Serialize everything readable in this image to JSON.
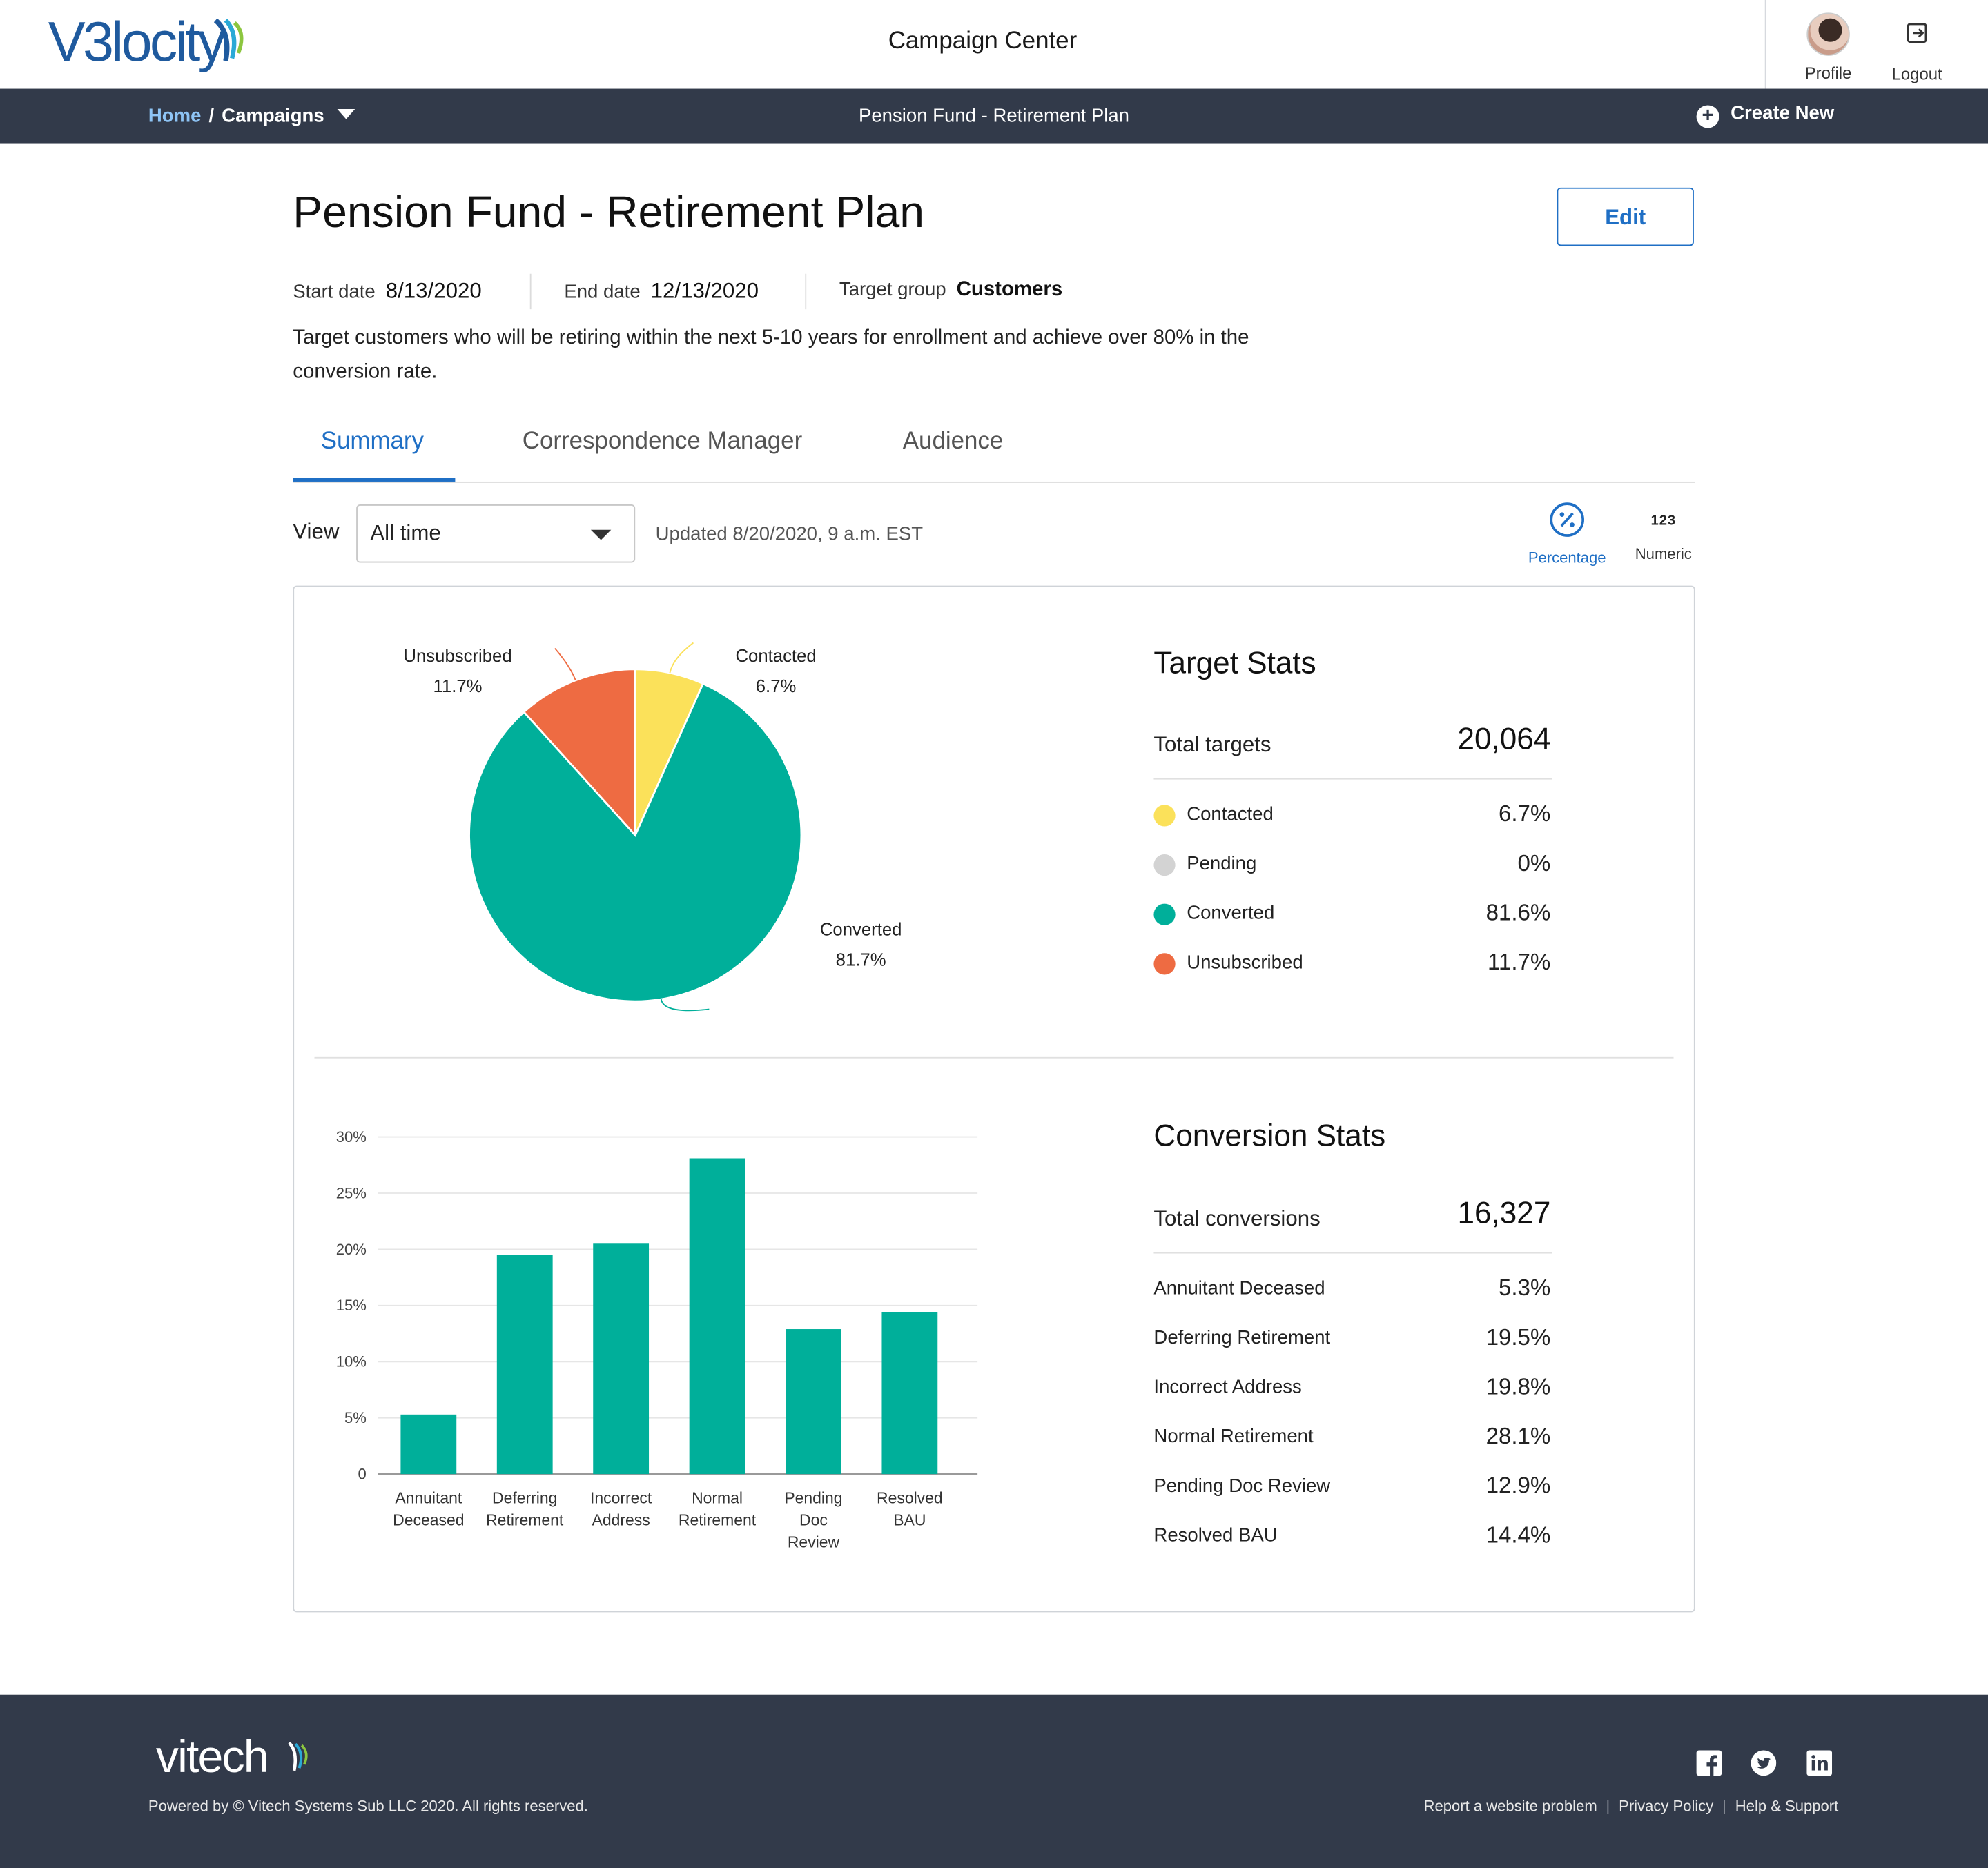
{
  "brand": {
    "logo_text": "V3locity"
  },
  "header": {
    "app_title": "Campaign Center",
    "profile_label": "Profile",
    "logout_label": "Logout"
  },
  "nav": {
    "home_label": "Home",
    "separator": "/",
    "campaigns_label": "Campaigns",
    "current_page": "Pension Fund - Retirement Plan",
    "create_new_label": "Create New"
  },
  "campaign": {
    "title": "Pension Fund - Retirement Plan",
    "edit_label": "Edit",
    "start_date_label": "Start date",
    "start_date": "8/13/2020",
    "end_date_label": "End date",
    "end_date": "12/13/2020",
    "target_group_label": "Target group",
    "target_group": "Customers",
    "description": "Target customers who will be retiring within the next 5-10 years for enrollment and achieve over 80% in the conversion rate."
  },
  "tabs": [
    {
      "label": "Summary",
      "active": true
    },
    {
      "label": "Correspondence Manager",
      "active": false
    },
    {
      "label": "Audience",
      "active": false
    }
  ],
  "controls": {
    "view_label": "View",
    "view_value": "All time",
    "updated_text": "Updated 8/20/2020, 9 a.m. EST",
    "percentage_label": "Percentage",
    "numeric_label": "Numeric",
    "numeric_glyph": "123"
  },
  "target_stats": {
    "title": "Target Stats",
    "total_label": "Total targets",
    "total_value": "20,064",
    "rows": [
      {
        "label": "Contacted",
        "value": "6.7%",
        "color": "#fbe15a"
      },
      {
        "label": "Pending",
        "value": "0%",
        "color": "#d3d3d3"
      },
      {
        "label": "Converted",
        "value": "81.6%",
        "color": "#00af9a"
      },
      {
        "label": "Unsubscribed",
        "value": "11.7%",
        "color": "#ee6b42"
      }
    ]
  },
  "conversion_stats": {
    "title": "Conversion Stats",
    "total_label": "Total conversions",
    "total_value": "16,327",
    "rows": [
      {
        "label": "Annuitant Deceased",
        "value": "5.3%"
      },
      {
        "label": "Deferring Retirement",
        "value": "19.5%"
      },
      {
        "label": "Incorrect Address",
        "value": "19.8%"
      },
      {
        "label": "Normal Retirement",
        "value": "28.1%"
      },
      {
        "label": "Pending Doc Review",
        "value": "12.9%"
      },
      {
        "label": "Resolved BAU",
        "value": "14.4%"
      }
    ]
  },
  "chart_data": [
    {
      "type": "pie",
      "slices": [
        {
          "label": "Unsubscribed",
          "value": 11.7,
          "display": "11.7%",
          "color": "#ee6b42"
        },
        {
          "label": "Contacted",
          "value": 6.7,
          "display": "6.7%",
          "color": "#fbe15a"
        },
        {
          "label": "Converted",
          "value": 81.7,
          "display": "81.7%",
          "color": "#00af9a"
        }
      ]
    },
    {
      "type": "bar",
      "categories": [
        "Annuitant Deceased",
        "Deferring Retirement",
        "Incorrect Address",
        "Normal Retirement",
        "Pending Doc Review",
        "Resolved BAU"
      ],
      "category_lines": [
        [
          "Annuitant",
          "Deceased"
        ],
        [
          "Deferring",
          "Retirement"
        ],
        [
          "Incorrect",
          "Address"
        ],
        [
          "Normal",
          "Retirement"
        ],
        [
          "Pending",
          "Doc",
          "Review"
        ],
        [
          "Resolved",
          "BAU"
        ]
      ],
      "values": [
        5.3,
        19.5,
        20.5,
        28.1,
        12.9,
        14.4
      ],
      "ylim": [
        0,
        30
      ],
      "yticks": [
        0,
        5,
        10,
        15,
        20,
        25,
        30
      ],
      "ytick_labels": [
        "0",
        "5%",
        "10%",
        "15%",
        "20%",
        "25%",
        "30%"
      ],
      "grid": true,
      "color": "#00af9a"
    }
  ],
  "footer": {
    "logo_text": "vitech",
    "powered_by": "Powered by © Vitech Systems Sub LLC 2020. All rights reserved.",
    "links": [
      "Report a website problem",
      "Privacy Policy",
      "Help & Support"
    ]
  }
}
